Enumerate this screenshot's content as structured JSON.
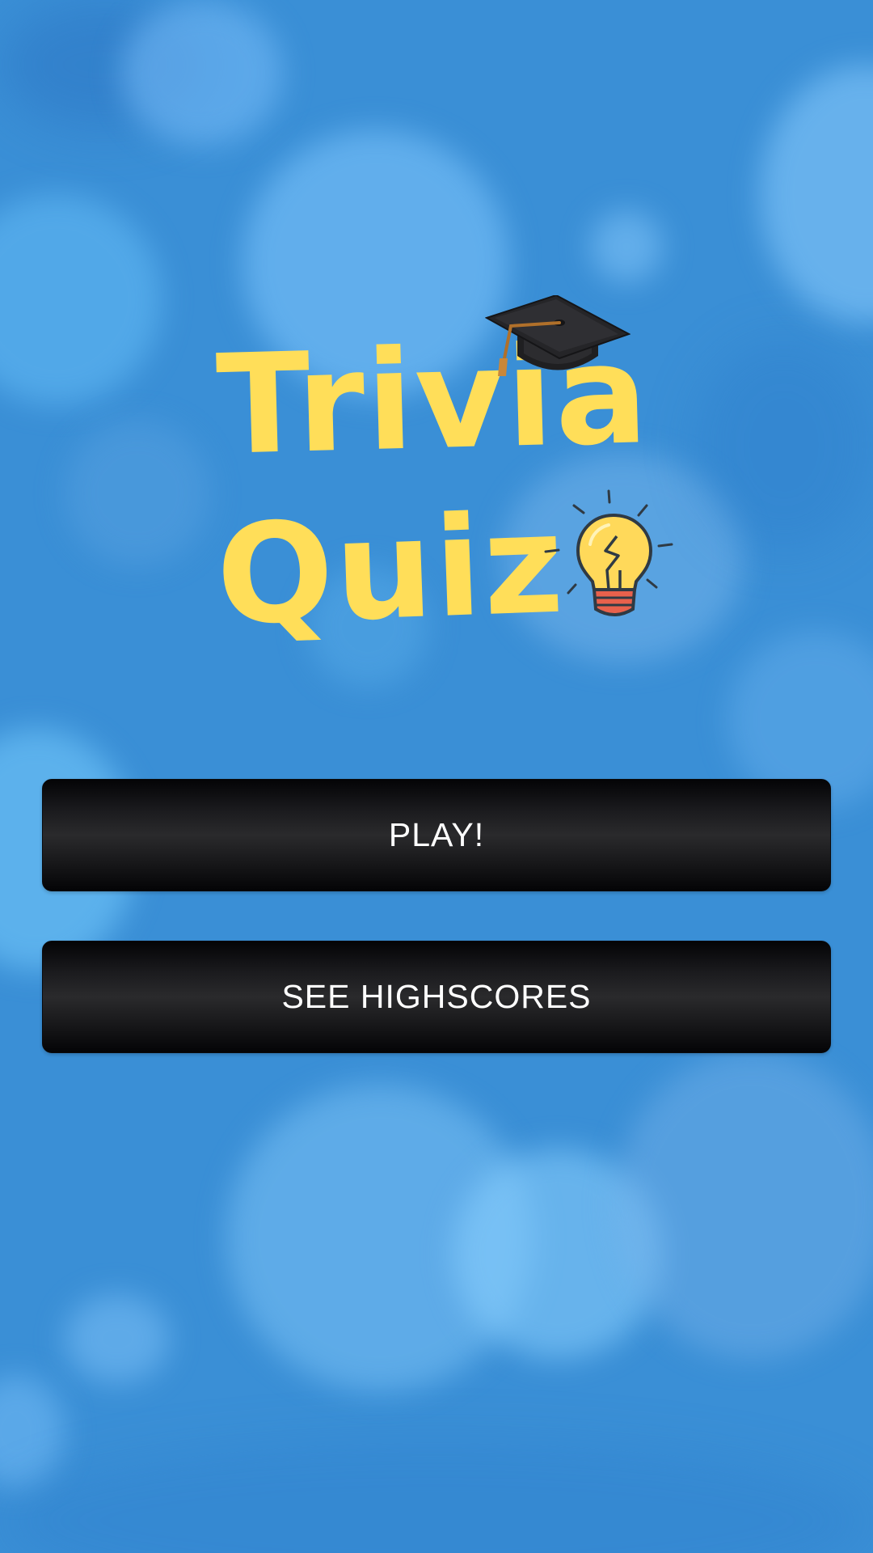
{
  "logo": {
    "title_line1": "Trivia",
    "title_line2": "Quiz",
    "title_color": "#ffde59",
    "cap_icon": "graduation-cap-icon",
    "bulb_icon": "light-bulb-icon"
  },
  "menu": {
    "play_label": "PLAY!",
    "highscores_label": "SEE HIGHSCORES"
  },
  "colors": {
    "background": "#3a8fd6",
    "button": "#1b1b1e",
    "button_text": "#ffffff",
    "bulb_yellow": "#ffd95a",
    "bulb_base": "#e8614c"
  }
}
